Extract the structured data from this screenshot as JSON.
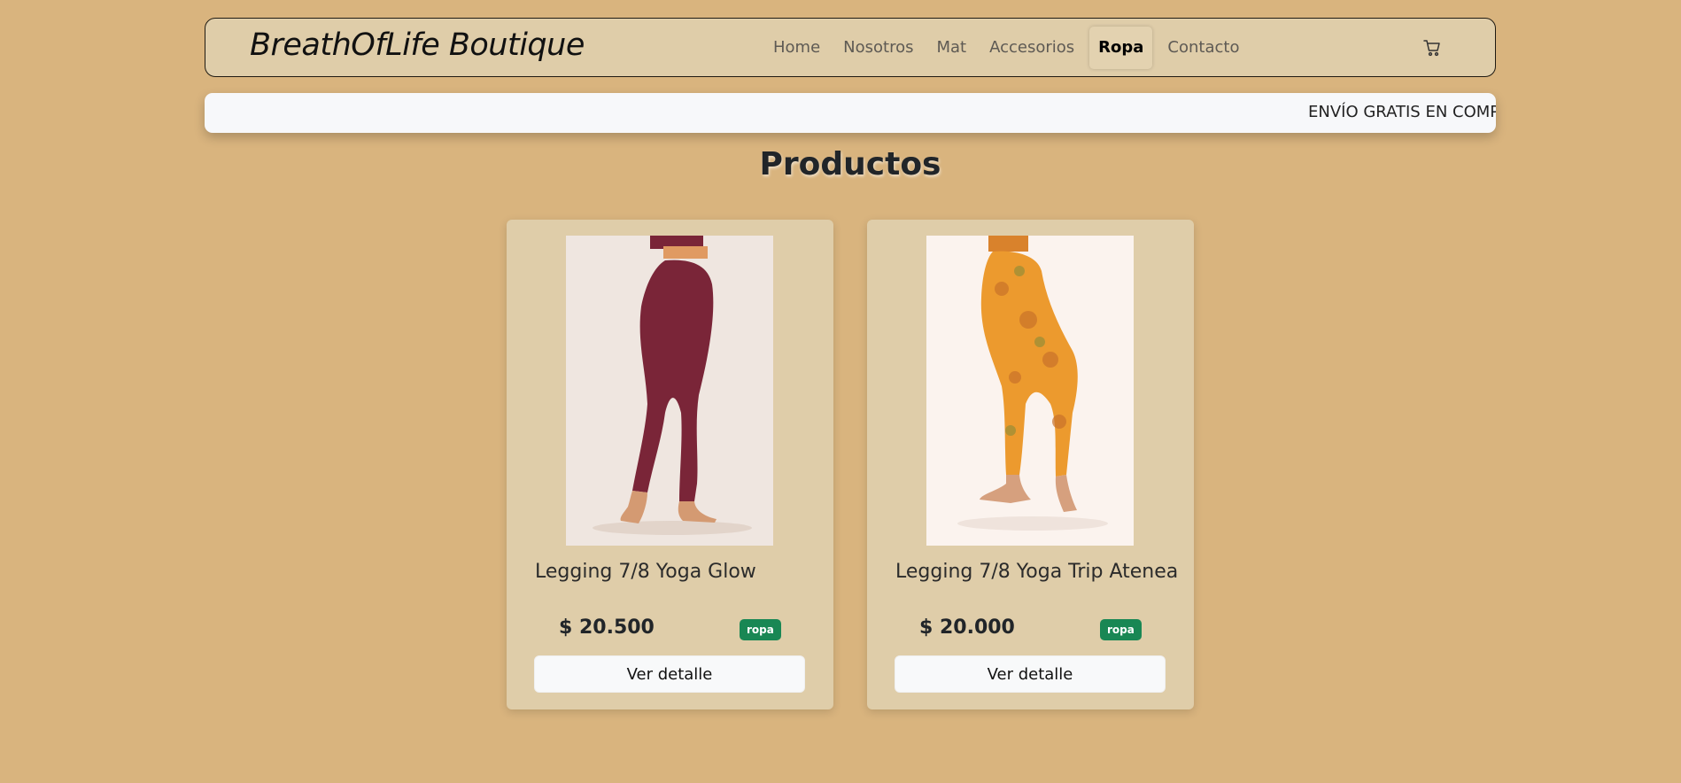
{
  "header": {
    "brand": "BreathOfLife Boutique",
    "nav": [
      "Home",
      "Nosotros",
      "Mat",
      "Accesorios",
      "Ropa",
      "Contacto"
    ],
    "active_nav": "Ropa",
    "cart_icon": "cart-icon"
  },
  "ticker": {
    "text": "ENVÍO GRATIS EN COMPRA"
  },
  "main": {
    "title": "Productos",
    "products": [
      {
        "name": "Legging 7/8 Yoga Glow",
        "price": "$ 20.500",
        "badge": "ropa",
        "button": "Ver detalle",
        "image_color": "#7a2538",
        "image_bg": "#efe6e0"
      },
      {
        "name": "Legging 7/8 Yoga Trip Atenea",
        "price": "$ 20.000",
        "badge": "ropa",
        "button": "Ver detalle",
        "image_color": "#ec9a2e",
        "image_bg": "#fbf3ee"
      }
    ]
  },
  "colors": {
    "page_bg": "#d9b47e",
    "card_bg": "#dfcda9",
    "badge_bg": "#198754"
  }
}
